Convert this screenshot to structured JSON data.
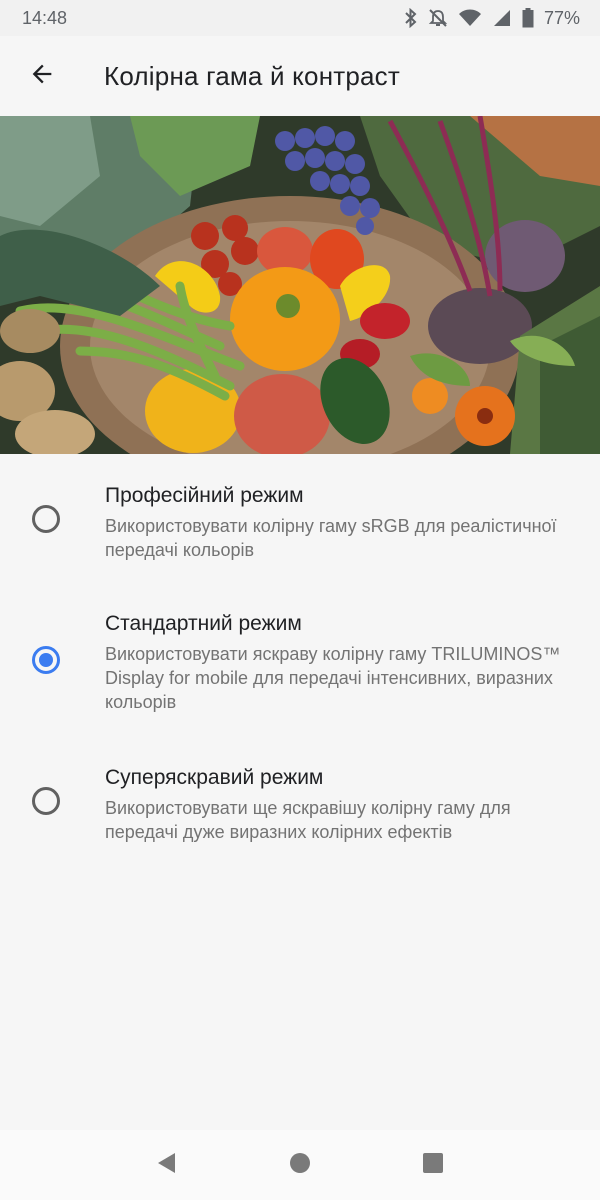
{
  "status_bar": {
    "time": "14:48",
    "battery": "77%",
    "icons": [
      "bluetooth-icon",
      "notifications-off-icon",
      "wifi-icon",
      "signal-icon",
      "battery-icon"
    ]
  },
  "app_bar": {
    "back_icon": "arrow-back-icon",
    "title": "Колірна гама й контраст"
  },
  "hero": {
    "content": "vegetables photo"
  },
  "options": [
    {
      "title": "Професійний режим",
      "description": "Використовувати колірну гаму sRGB для реалістичної передачі кольорів",
      "selected": false
    },
    {
      "title": "Стандартний режим",
      "description": "Використовувати яскраву колірну гаму TRILUMINOS™ Display for mobile для передачі інтенсивних, виразних кольорів",
      "selected": true
    },
    {
      "title": "Суперяскравий режим",
      "description": "Використовувати ще яскравішу колірну гаму для передачі дуже виразних колірних ефектів",
      "selected": false
    }
  ],
  "nav_bar": {
    "buttons": [
      "back-triangle-icon",
      "home-circle-icon",
      "recents-square-icon"
    ]
  },
  "colors": {
    "accent": "#3b7cf0",
    "background": "#f6f6f6",
    "text_primary": "#202124",
    "text_secondary": "#737373"
  }
}
